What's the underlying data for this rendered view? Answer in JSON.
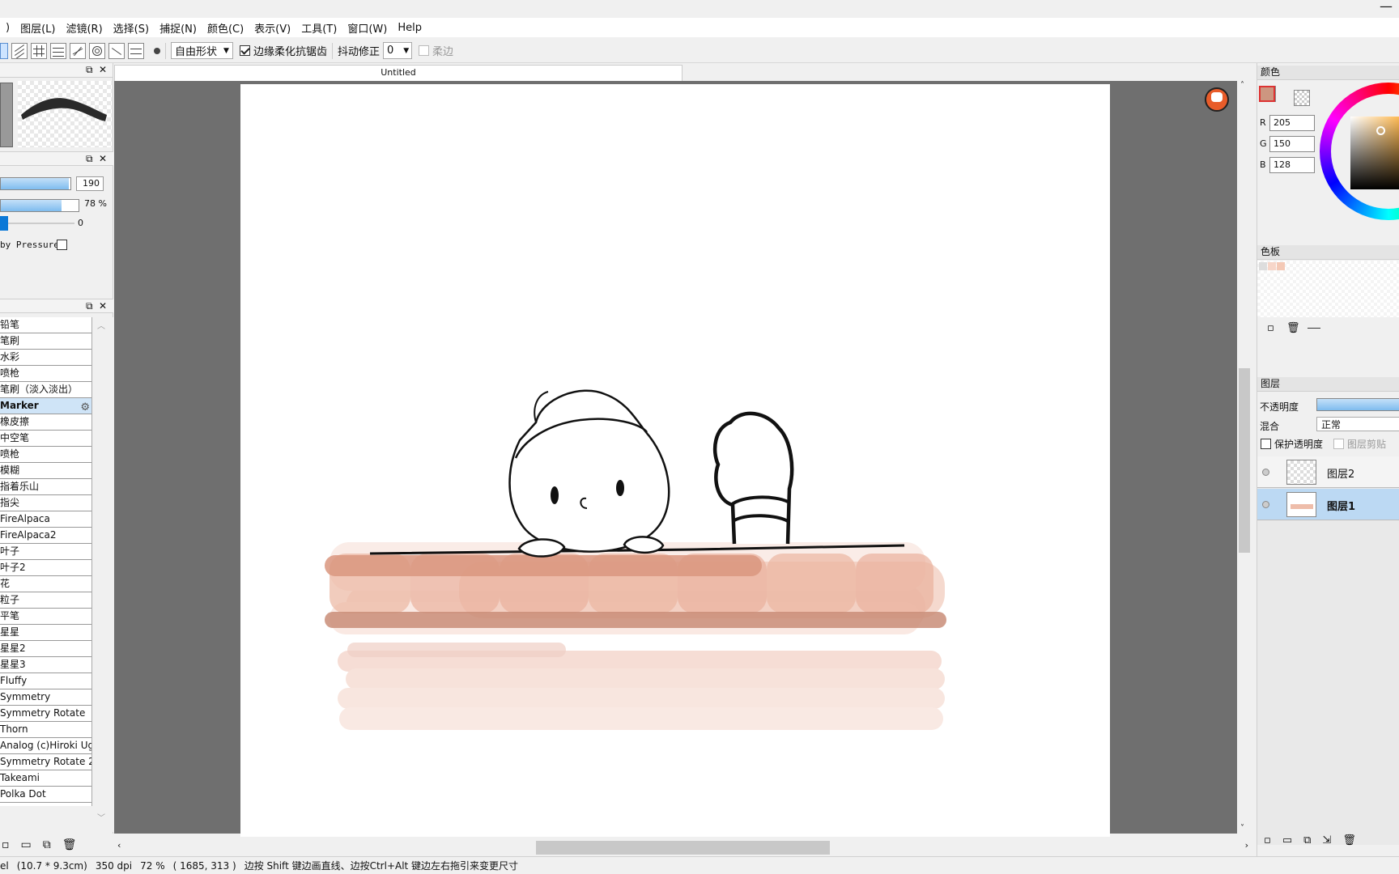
{
  "window": {
    "close_glyph": "—"
  },
  "menubar": {
    "items": [
      ")",
      "图层(L)",
      "滤镜(R)",
      "选择(S)",
      "捕捉(N)",
      "颜色(C)",
      "表示(V)",
      "工具(T)",
      "窗口(W)",
      "Help"
    ]
  },
  "toolbar": {
    "shape_select": "自由形状",
    "antialias_label": "边缘柔化抗锯齿",
    "stabilizer_label": "抖动修正",
    "stabilizer_value": "0",
    "soft_edge_label": "柔边"
  },
  "brush_panel": {
    "size_value": "190",
    "opacity_value": "78 %",
    "opacity_fraction": 0.78,
    "size_fraction": 0.98,
    "blur_value": "0",
    "pressure_label": "by Pressure"
  },
  "brush_list": {
    "items": [
      "铅笔",
      "笔刷",
      "水彩",
      "喷枪",
      "笔刷（淡入淡出）",
      "Marker",
      "橡皮擦",
      "中空笔",
      "喷枪",
      "模糊",
      "指着乐山",
      "指尖",
      "FireAlpaca",
      "FireAlpaca2",
      "叶子",
      "叶子2",
      "花",
      "粒子",
      "平笔",
      "星星",
      "星星2",
      "星星3",
      "Fluffy",
      "Symmetry",
      "Symmetry Rotate",
      "Thorn",
      "Analog (c)Hiroki Uga",
      "Symmetry Rotate 2",
      "Takeami",
      "Polka Dot"
    ],
    "selected_index": 5
  },
  "document": {
    "tab_title": "Untitled"
  },
  "color_panel": {
    "title": "颜色",
    "r_label": "R",
    "g_label": "G",
    "b_label": "B",
    "r": "205",
    "g": "150",
    "b": "128",
    "primary_color": "#cd9680"
  },
  "palette_panel": {
    "title": "色板"
  },
  "layers_panel": {
    "title": "图层",
    "opacity_label": "不透明度",
    "blend_label": "混合",
    "blend_value": "正常",
    "protect_label": "保护透明度",
    "clip_label": "图层剪贴",
    "layers": [
      {
        "name": "图层2",
        "selected": false
      },
      {
        "name": "图层1",
        "selected": true
      }
    ]
  },
  "statusbar": {
    "unit": "el",
    "size": "(10.7 * 9.3cm)",
    "dpi": "350 dpi",
    "zoom": "72 %",
    "coords": "( 1685, 313 )",
    "hint": "边按 Shift 键边画直线、边按Ctrl+Alt 键边左右拖引来变更尺寸"
  }
}
